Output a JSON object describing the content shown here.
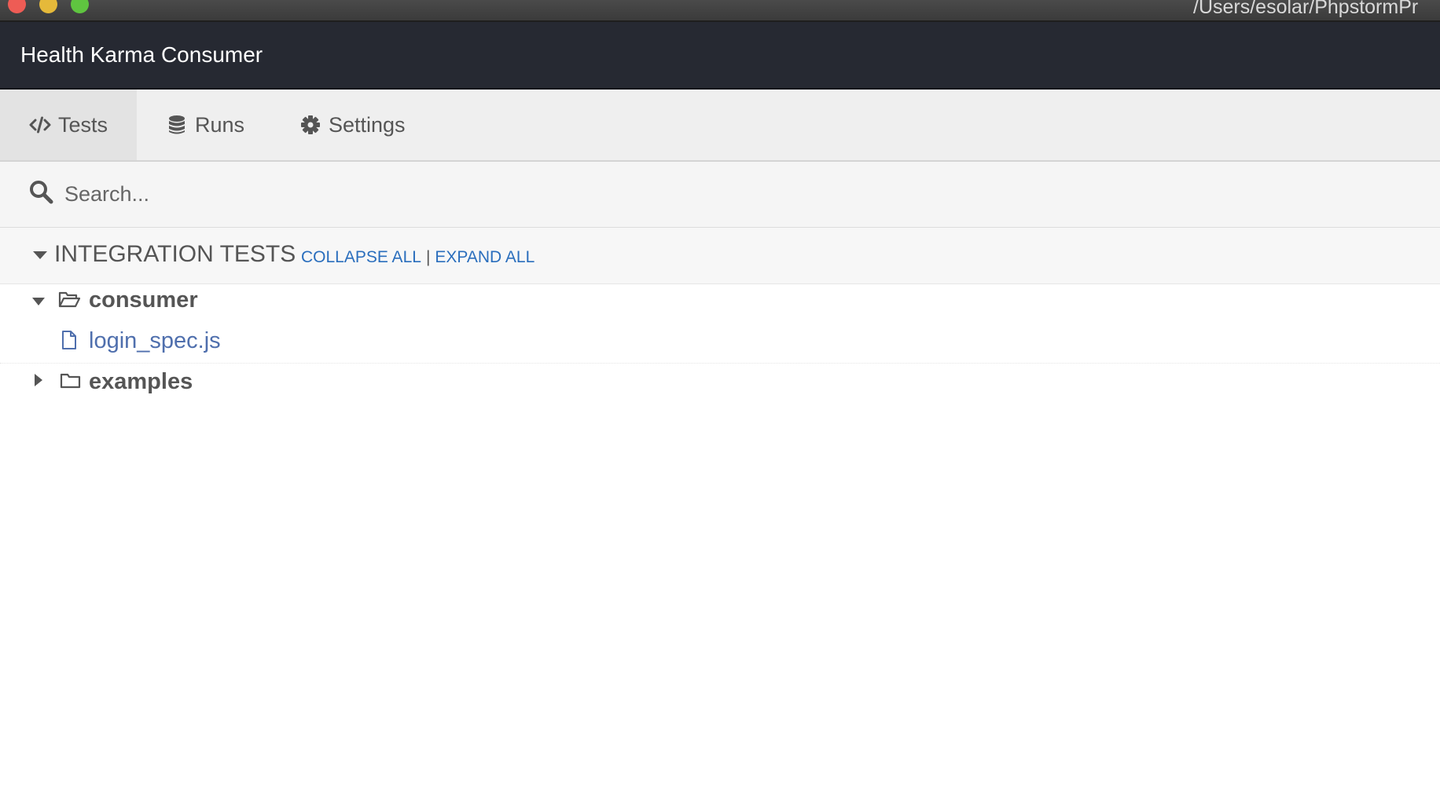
{
  "window": {
    "path": "/Users/esolar/PhpstormPr"
  },
  "app": {
    "title": "Health Karma Consumer"
  },
  "tabs": [
    {
      "label": "Tests",
      "icon": "code-icon",
      "active": true
    },
    {
      "label": "Runs",
      "icon": "database-icon",
      "active": false
    },
    {
      "label": "Settings",
      "icon": "gear-icon",
      "active": false
    }
  ],
  "search": {
    "placeholder": "Search...",
    "value": ""
  },
  "section": {
    "title": "INTEGRATION TESTS",
    "collapse_all": "COLLAPSE ALL",
    "separator": "|",
    "expand_all": "EXPAND ALL"
  },
  "tree": [
    {
      "type": "folder",
      "name": "consumer",
      "expanded": true
    },
    {
      "type": "file",
      "name": "login_spec.js"
    },
    {
      "type": "folder",
      "name": "examples",
      "expanded": false
    }
  ],
  "colors": {
    "header_bg": "#262932",
    "link": "#2a6ebd",
    "file_link": "#4f6fad"
  }
}
